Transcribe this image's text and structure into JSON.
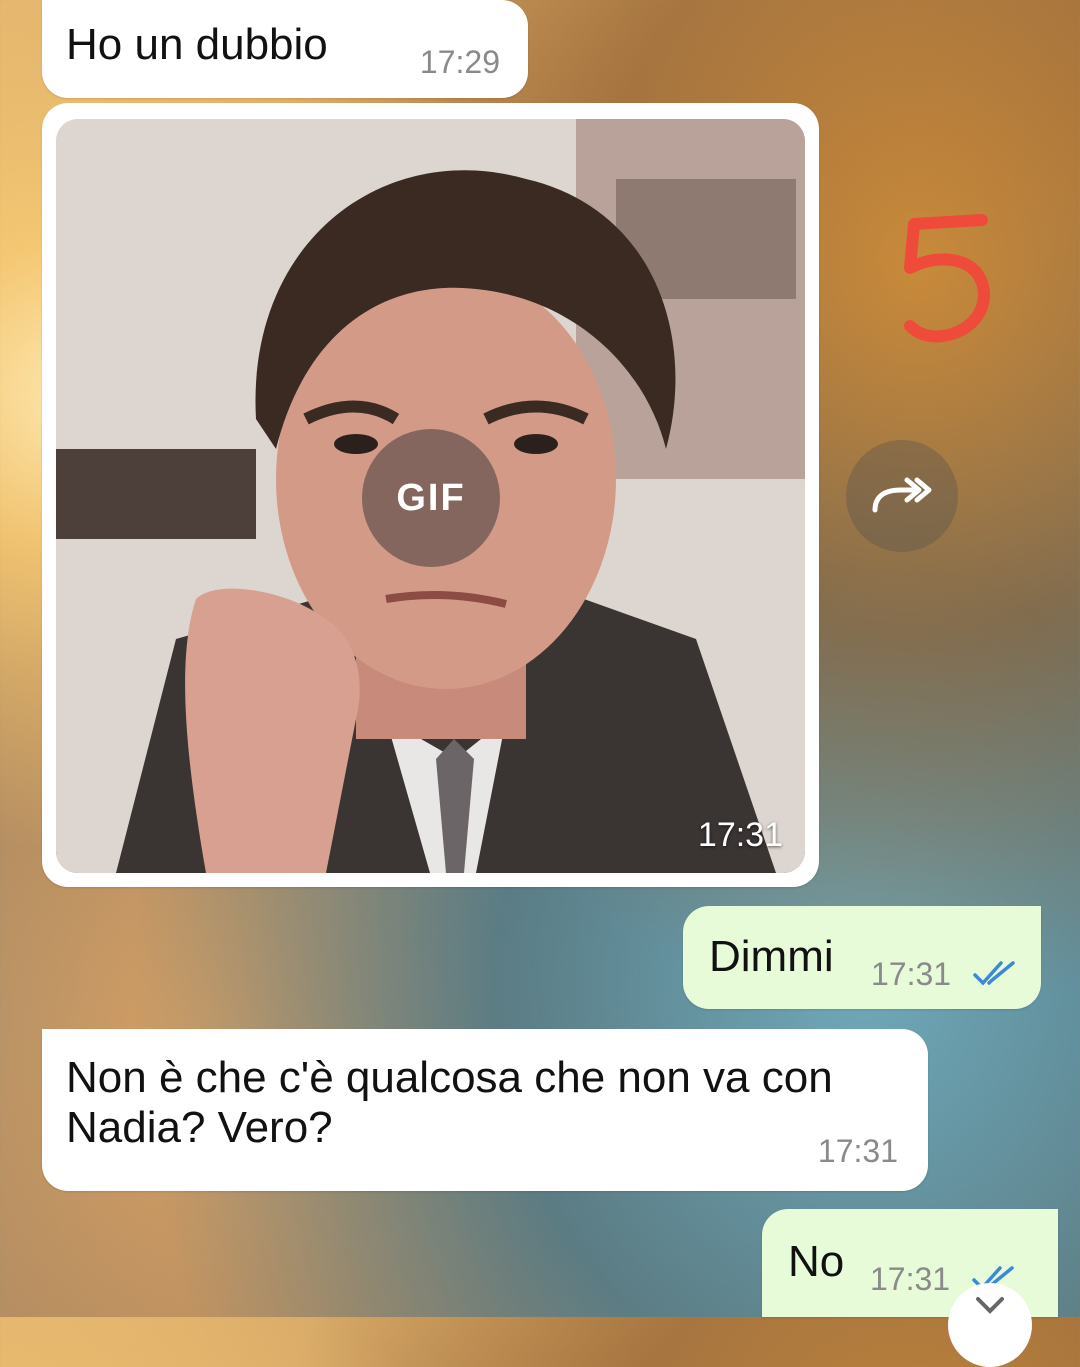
{
  "messages": [
    {
      "direction": "incoming",
      "text": "Ho un dubbio",
      "time": "17:29"
    },
    {
      "direction": "incoming",
      "type": "gif",
      "badge": "GIF",
      "time": "17:31"
    },
    {
      "direction": "outgoing",
      "text": "Dimmi",
      "time": "17:31",
      "status": "read"
    },
    {
      "direction": "incoming",
      "text": "Non è che c'è qualcosa che non va con Nadia? Vero?",
      "time": "17:31"
    },
    {
      "direction": "outgoing",
      "text": "No",
      "time": "17:31",
      "status": "read"
    }
  ],
  "overlay_annotation": "5",
  "colors": {
    "incoming_bubble": "#ffffff",
    "outgoing_bubble": "#e7fbd9",
    "read_ticks": "#3b8ad8",
    "annotation": "#ee4b3b"
  },
  "icons": [
    "gif-badge",
    "forward-icon",
    "double-check-icon",
    "scroll-down-icon"
  ]
}
